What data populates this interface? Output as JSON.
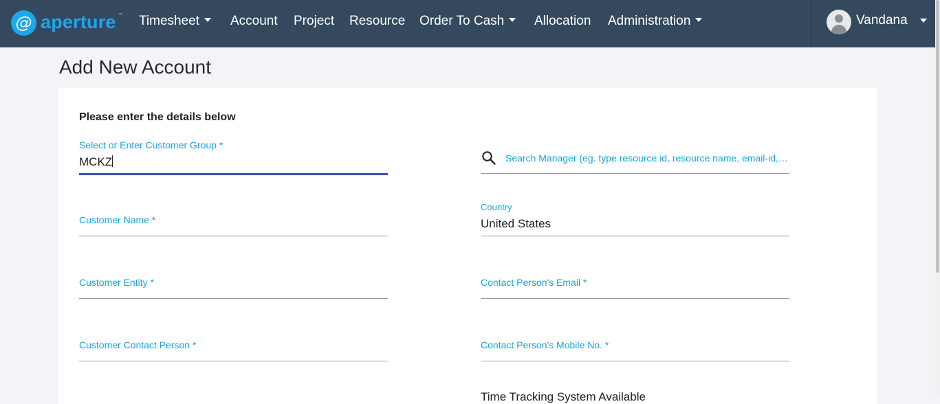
{
  "brand": {
    "logo_glyph": "@",
    "name": "aperture",
    "tm": "™",
    "color": "#1aa7ec"
  },
  "nav": {
    "timesheet": "Timesheet",
    "account": "Account",
    "project": "Project",
    "resource": "Resource",
    "order_to_cash": "Order To Cash",
    "allocation": "Allocation",
    "administration": "Administration"
  },
  "user": {
    "name": "Vandana"
  },
  "page": {
    "title": "Add New Account",
    "section_heading": "Please enter the details below"
  },
  "form": {
    "customer_group": {
      "label": "Select or Enter Customer Group *",
      "value": "MCKZ"
    },
    "search_manager": {
      "placeholder": "Search Manager (eg. type resource id, resource name, email-id, type"
    },
    "customer_name": {
      "label": "Customer Name *"
    },
    "country": {
      "label": "Country",
      "value": "United States"
    },
    "customer_entity": {
      "label": "Customer Entity *"
    },
    "contact_email": {
      "label": "Contact Person's Email *"
    },
    "contact_person": {
      "label": "Customer Contact Person *"
    },
    "contact_mobile": {
      "label": "Contact Person's Mobile No. *"
    },
    "partial_field": {
      "text": "Time Tracking System Available"
    }
  },
  "colors": {
    "navbar": "#34495e",
    "accent": "#17a5d9",
    "active_underline": "#3f51b5"
  }
}
